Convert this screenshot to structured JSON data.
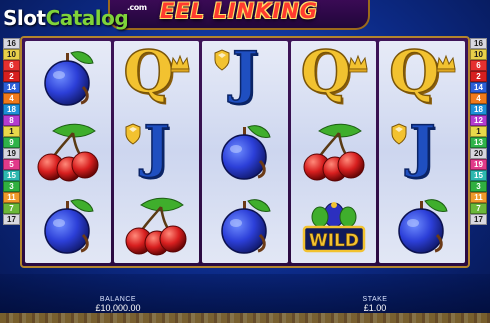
{
  "watermark": {
    "slot": "Slot",
    "catalog": "Catalog",
    "com": ".com"
  },
  "game": {
    "title": "EEL LINKING"
  },
  "paylines": {
    "left": [
      {
        "label": "16",
        "color": "#d8d8e0",
        "text": "#1a1a1a"
      },
      {
        "label": "10",
        "color": "#e8d04a",
        "text": "#1a1a1a"
      },
      {
        "label": "6",
        "color": "#e63030",
        "text": "#ffffff"
      },
      {
        "label": "2",
        "color": "#d71f1f",
        "text": "#ffffff"
      },
      {
        "label": "14",
        "color": "#2d5fd8",
        "text": "#ffffff"
      },
      {
        "label": "4",
        "color": "#f07a1b",
        "text": "#ffffff"
      },
      {
        "label": "18",
        "color": "#1e8fd8",
        "text": "#ffffff"
      },
      {
        "label": "8",
        "color": "#b43bd0",
        "text": "#ffffff"
      },
      {
        "label": "1",
        "color": "#e8d84a",
        "text": "#1a1a1a"
      },
      {
        "label": "9",
        "color": "#2fb34a",
        "text": "#ffffff"
      },
      {
        "label": "19",
        "color": "#d8d8e0",
        "text": "#1a1a1a"
      },
      {
        "label": "5",
        "color": "#e23a8a",
        "text": "#ffffff"
      },
      {
        "label": "15",
        "color": "#2db8b0",
        "text": "#ffffff"
      },
      {
        "label": "3",
        "color": "#30b040",
        "text": "#ffffff"
      },
      {
        "label": "11",
        "color": "#f09a2a",
        "text": "#ffffff"
      },
      {
        "label": "7",
        "color": "#6ab83a",
        "text": "#ffffff"
      },
      {
        "label": "17",
        "color": "#d8d8e0",
        "text": "#1a1a1a"
      }
    ],
    "right": [
      {
        "label": "16",
        "color": "#d8d8e0",
        "text": "#1a1a1a"
      },
      {
        "label": "10",
        "color": "#e8d04a",
        "text": "#1a1a1a"
      },
      {
        "label": "6",
        "color": "#e63030",
        "text": "#ffffff"
      },
      {
        "label": "2",
        "color": "#d71f1f",
        "text": "#ffffff"
      },
      {
        "label": "14",
        "color": "#2d5fd8",
        "text": "#ffffff"
      },
      {
        "label": "4",
        "color": "#f07a1b",
        "text": "#ffffff"
      },
      {
        "label": "18",
        "color": "#1e8fd8",
        "text": "#ffffff"
      },
      {
        "label": "12",
        "color": "#b43bd0",
        "text": "#ffffff"
      },
      {
        "label": "1",
        "color": "#e8d84a",
        "text": "#1a1a1a"
      },
      {
        "label": "13",
        "color": "#2fb34a",
        "text": "#ffffff"
      },
      {
        "label": "20",
        "color": "#d8d8e0",
        "text": "#1a1a1a"
      },
      {
        "label": "19",
        "color": "#e23a8a",
        "text": "#ffffff"
      },
      {
        "label": "15",
        "color": "#2db8b0",
        "text": "#ffffff"
      },
      {
        "label": "3",
        "color": "#30b040",
        "text": "#ffffff"
      },
      {
        "label": "11",
        "color": "#f09a2a",
        "text": "#ffffff"
      },
      {
        "label": "7",
        "color": "#6ab83a",
        "text": "#ffffff"
      },
      {
        "label": "17",
        "color": "#d8d8e0",
        "text": "#1a1a1a"
      }
    ]
  },
  "reels": [
    [
      "plum",
      "cherries",
      "plum"
    ],
    [
      "queen",
      "jack",
      "cherries"
    ],
    [
      "jack",
      "plum",
      "plum"
    ],
    [
      "queen",
      "cherries",
      "wild"
    ],
    [
      "queen",
      "jack",
      "plum"
    ]
  ],
  "symbols": {
    "queen_letter": "Q",
    "jack_letter": "J",
    "wild_text": "WILD"
  },
  "meters": {
    "balance_label": "BALANCE",
    "balance_value": "£10,000.00",
    "stake_label": "STAKE",
    "stake_value": "£1.00"
  },
  "colors": {
    "accent_gold": "#f2c230",
    "letter_blue": "#1f4fc0",
    "plum": "#2c3fd8",
    "cherry": "#d81f1f"
  }
}
